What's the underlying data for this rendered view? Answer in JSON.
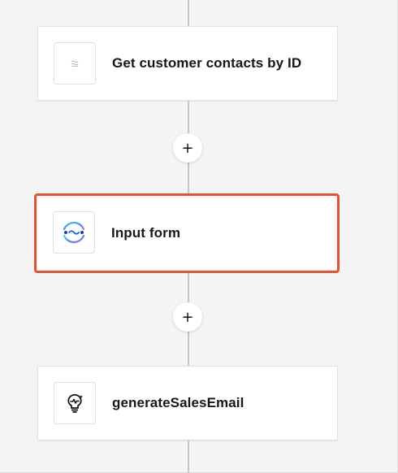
{
  "flow": {
    "nodes": [
      {
        "label": "Get customer contacts by ID",
        "icon": "tool-icon",
        "selected": false
      },
      {
        "label": "Input form",
        "icon": "input-form-icon",
        "selected": true
      },
      {
        "label": "generateSalesEmail",
        "icon": "ai-skill-icon",
        "selected": false
      }
    ],
    "add_step_glyph": "+",
    "accent_color": "#e8502e"
  }
}
